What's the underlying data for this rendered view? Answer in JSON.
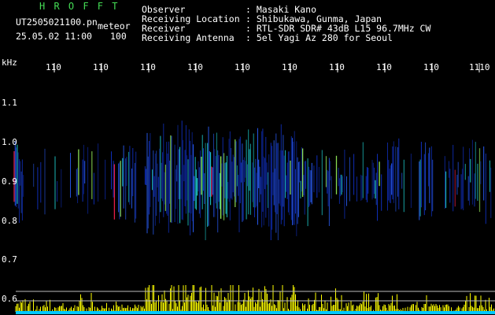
{
  "header": {
    "app_title": "H R O F F T",
    "file_name": "UT2505021100.pn",
    "mode": "meteor",
    "date_time": "25.05.02 11:00",
    "count": "100",
    "fields": [
      {
        "label": "Observer",
        "value": ": Masaki Kano"
      },
      {
        "label": "Receiving Location",
        "value": ": Shibukawa, Gunma, Japan"
      },
      {
        "label": "Receiver",
        "value": ": RTL-SDR SDR# 43dB L15 96.7MHz CW"
      },
      {
        "label": "Receiving Antenna",
        "value": ": 5el Yagi Az 280 for Seoul"
      }
    ]
  },
  "freq_axis": {
    "unit": "kHz",
    "ticks": [
      "1.1",
      "1.0",
      "0.9",
      "0.8",
      "0.7",
      "0.6"
    ]
  },
  "time_axis": {
    "ticks": [
      "110",
      "110",
      "110",
      "110",
      "110",
      "110",
      "110",
      "110",
      "110",
      "1110"
    ]
  },
  "colors": {
    "background": "#000000",
    "title": "#44dd55",
    "text": "#ffffff",
    "signal_low": "#1030c0",
    "signal_mid": "#20e0e0",
    "signal_high": "#ff2050",
    "amplitude": "#ffff00",
    "baseline": "#00c8ff"
  }
}
